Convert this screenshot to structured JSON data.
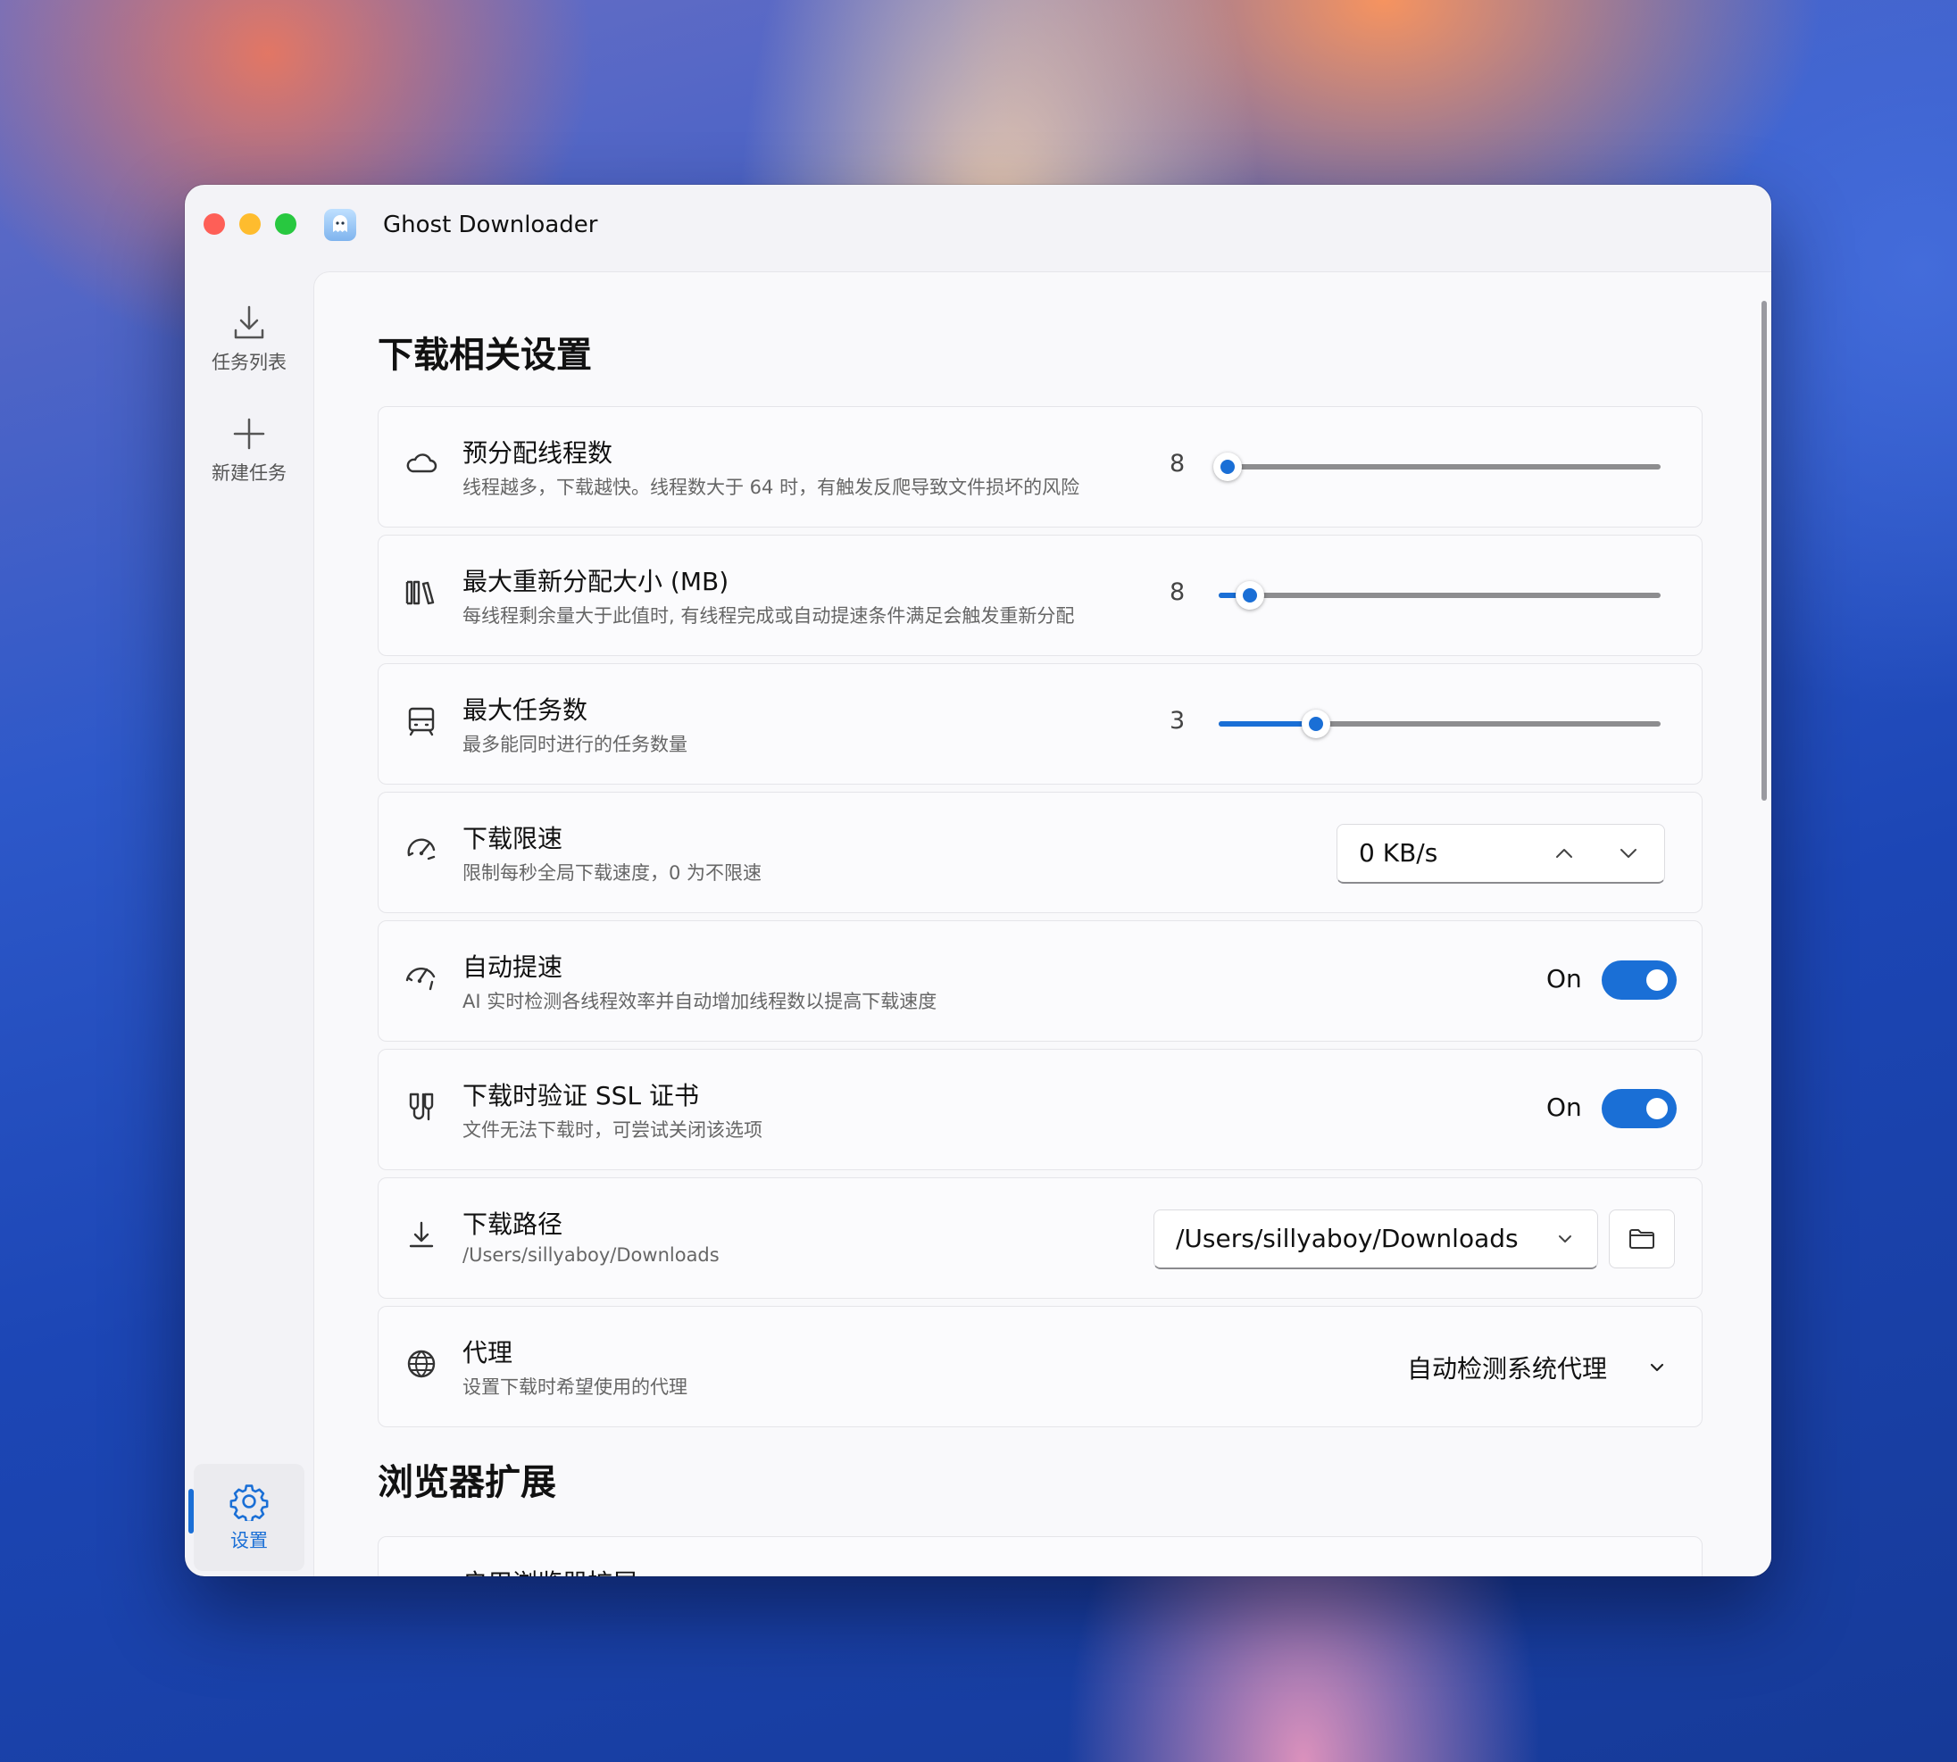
{
  "window": {
    "title": "Ghost Downloader"
  },
  "sidebar": {
    "items": [
      {
        "label": "任务列表",
        "icon": "download-icon"
      },
      {
        "label": "新建任务",
        "icon": "plus-icon"
      }
    ],
    "settings": {
      "label": "设置",
      "icon": "gear-icon"
    }
  },
  "sections": {
    "download": "下载相关设置",
    "browser": "浏览器扩展"
  },
  "settings": {
    "threads": {
      "label": "预分配线程数",
      "desc": "线程越多，下载越快。线程数大于 64 时，有触发反爬导致文件损坏的风险",
      "value": "8",
      "fraction": 0.02,
      "icon": "cloud-icon"
    },
    "realloc": {
      "label": "最大重新分配大小 (MB)",
      "desc": "每线程剩余量大于此值时, 有线程完成或自动提速条件满足会触发重新分配",
      "value": "8",
      "fraction": 0.07,
      "icon": "books-icon"
    },
    "max_tasks": {
      "label": "最大任务数",
      "desc": "最多能同时进行的任务数量",
      "value": "3",
      "fraction": 0.22,
      "icon": "train-icon"
    },
    "speed_limit": {
      "label": "下载限速",
      "desc": "限制每秒全局下载速度，0 为不限速",
      "value": "0 KB/s",
      "icon": "speedometer-icon"
    },
    "auto_boost": {
      "label": "自动提速",
      "desc": "AI 实时检测各线程效率并自动增加线程数以提高下载速度",
      "state": "On",
      "icon": "gauge-icon"
    },
    "ssl": {
      "label": "下载时验证 SSL 证书",
      "desc": "文件无法下载时，可尝试关闭该选项",
      "state": "On",
      "icon": "certificate-icon"
    },
    "path": {
      "label": "下载路径",
      "desc": "/Users/sillyaboy/Downloads",
      "value": "/Users/sillyaboy/Downloads",
      "icon": "download-icon"
    },
    "proxy": {
      "label": "代理",
      "desc": "设置下载时希望使用的代理",
      "value": "自动检测系统代理",
      "icon": "globe-icon"
    },
    "browser_ext": {
      "label": "启用浏览器扩展"
    }
  },
  "colors": {
    "accent": "#1a6fd6"
  }
}
